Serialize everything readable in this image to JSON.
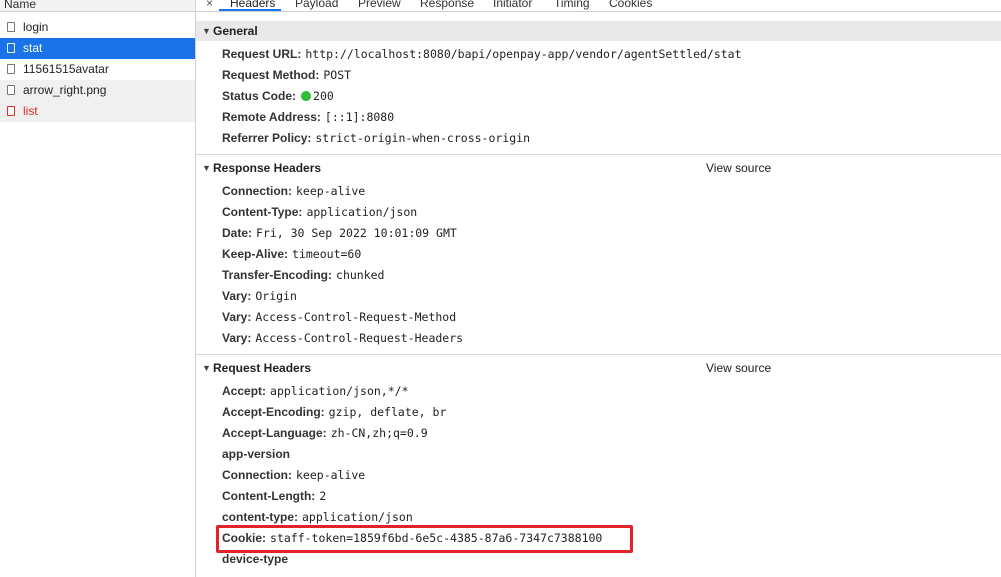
{
  "left": {
    "header": "Name",
    "requests": [
      {
        "name": "login",
        "state": "normal"
      },
      {
        "name": "stat",
        "state": "selected"
      },
      {
        "name": "11561515avatar",
        "state": "normal"
      },
      {
        "name": "arrow_right.png",
        "state": "normal"
      },
      {
        "name": "list",
        "state": "error"
      }
    ]
  },
  "tabs": {
    "close": "×",
    "items": [
      "Headers",
      "Payload",
      "Preview",
      "Response",
      "Initiator",
      "Timing",
      "Cookies"
    ],
    "active": "Headers"
  },
  "general": {
    "title": "General",
    "rows": [
      {
        "key": "Request URL:",
        "value": "http://localhost:8080/bapi/openpay-app/vendor/agentSettled/stat"
      },
      {
        "key": "Request Method:",
        "value": "POST"
      },
      {
        "key": "Status Code:",
        "value": "200"
      },
      {
        "key": "Remote Address:",
        "value": "[::1]:8080"
      },
      {
        "key": "Referrer Policy:",
        "value": "strict-origin-when-cross-origin"
      }
    ]
  },
  "response_headers": {
    "title": "Response Headers",
    "view_source": "View source",
    "rows": [
      {
        "key": "Connection:",
        "value": "keep-alive"
      },
      {
        "key": "Content-Type:",
        "value": "application/json"
      },
      {
        "key": "Date:",
        "value": "Fri, 30 Sep 2022 10:01:09 GMT"
      },
      {
        "key": "Keep-Alive:",
        "value": "timeout=60"
      },
      {
        "key": "Transfer-Encoding:",
        "value": "chunked"
      },
      {
        "key": "Vary:",
        "value": "Origin"
      },
      {
        "key": "Vary:",
        "value": "Access-Control-Request-Method"
      },
      {
        "key": "Vary:",
        "value": "Access-Control-Request-Headers"
      }
    ]
  },
  "request_headers": {
    "title": "Request Headers",
    "view_source": "View source",
    "rows": [
      {
        "key": "Accept:",
        "value": "application/json,*/*"
      },
      {
        "key": "Accept-Encoding:",
        "value": "gzip, deflate, br"
      },
      {
        "key": "Accept-Language:",
        "value": "zh-CN,zh;q=0.9"
      },
      {
        "key": "app-version",
        "value": ""
      },
      {
        "key": "Connection:",
        "value": "keep-alive"
      },
      {
        "key": "Content-Length:",
        "value": "2"
      },
      {
        "key": "content-type:",
        "value": "application/json"
      },
      {
        "key": "Cookie:",
        "value": "staff-token=1859f6bd-6e5c-4385-87a6-7347c7388100"
      },
      {
        "key": "device-type",
        "value": ""
      }
    ]
  },
  "colors": {
    "selected_row": "#1a73e8",
    "error_text": "#d93025",
    "status_ok": "#2fbf3a",
    "highlight_box": "#e0242a"
  }
}
